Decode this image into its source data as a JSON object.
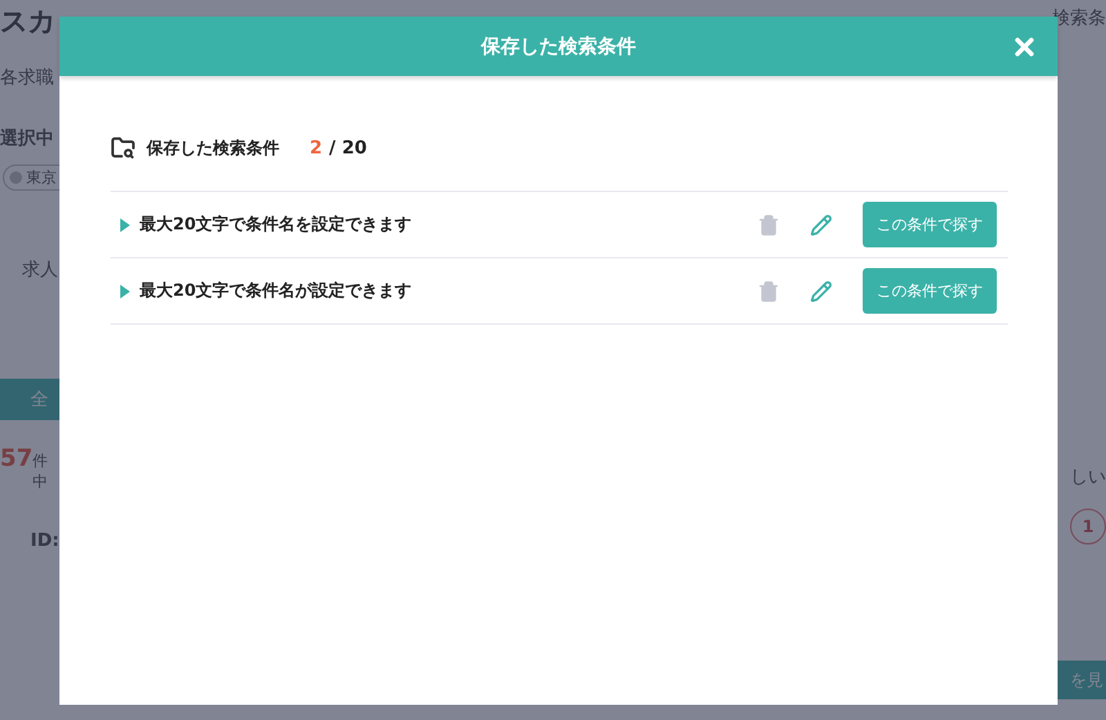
{
  "page": {
    "heading": "スカ",
    "note": "各求職",
    "selected_label": "選択中",
    "chip": "東京",
    "job_label": "求人",
    "all_button": "全",
    "count": "57",
    "count_suffix": "件中",
    "id_label": "ID:",
    "right_tab": "検索条",
    "sort": "しい",
    "badge": "1",
    "detail_button": "を見"
  },
  "modal": {
    "title": "保存した検索条件",
    "summary": {
      "label": "保存した検索条件",
      "count": "2",
      "total": "/ 20"
    },
    "items": [
      {
        "name": "最大20文字で条件名を設定できます",
        "expanded": false,
        "action": "この条件で探す"
      },
      {
        "name": "最大20文字で条件名が設定できます",
        "expanded": false,
        "action": "この条件で探す"
      }
    ]
  }
}
